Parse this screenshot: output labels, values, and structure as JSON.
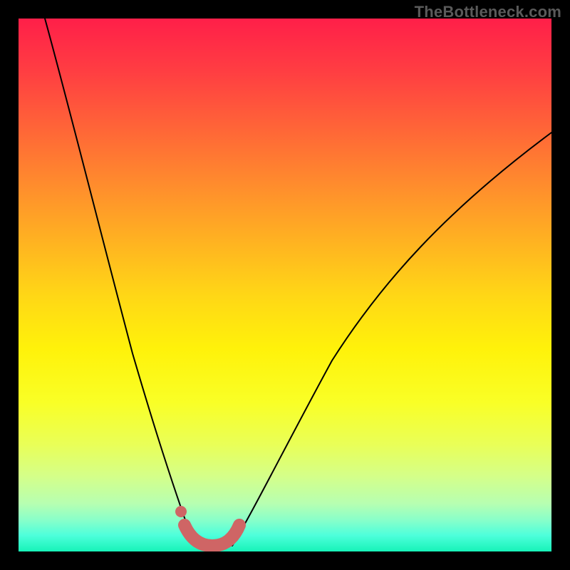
{
  "watermark": "TheBottleneck.com",
  "colors": {
    "frame": "#000000",
    "curve": "#000000",
    "marker": "#cf6565"
  },
  "chart_data": {
    "type": "line",
    "title": "",
    "xlabel": "",
    "ylabel": "",
    "xlim": [
      0,
      100
    ],
    "ylim": [
      0,
      100
    ],
    "series": [
      {
        "name": "left-curve",
        "x": [
          5,
          8,
          11,
          14,
          17,
          20,
          23,
          26,
          29,
          31,
          33
        ],
        "y": [
          100,
          86,
          72,
          59,
          47,
          36,
          26,
          17,
          9,
          4,
          1
        ]
      },
      {
        "name": "right-curve",
        "x": [
          40,
          44,
          49,
          55,
          62,
          70,
          79,
          89,
          100
        ],
        "y": [
          1,
          5,
          12,
          22,
          34,
          47,
          59,
          70,
          79
        ]
      },
      {
        "name": "marker-trough",
        "x": [
          31,
          33,
          35,
          37,
          39,
          41
        ],
        "y": [
          4,
          1,
          0.5,
          0.5,
          1,
          4
        ]
      }
    ],
    "annotations": [
      {
        "type": "point",
        "name": "marker-dot",
        "x": 30.5,
        "y": 7
      }
    ]
  }
}
